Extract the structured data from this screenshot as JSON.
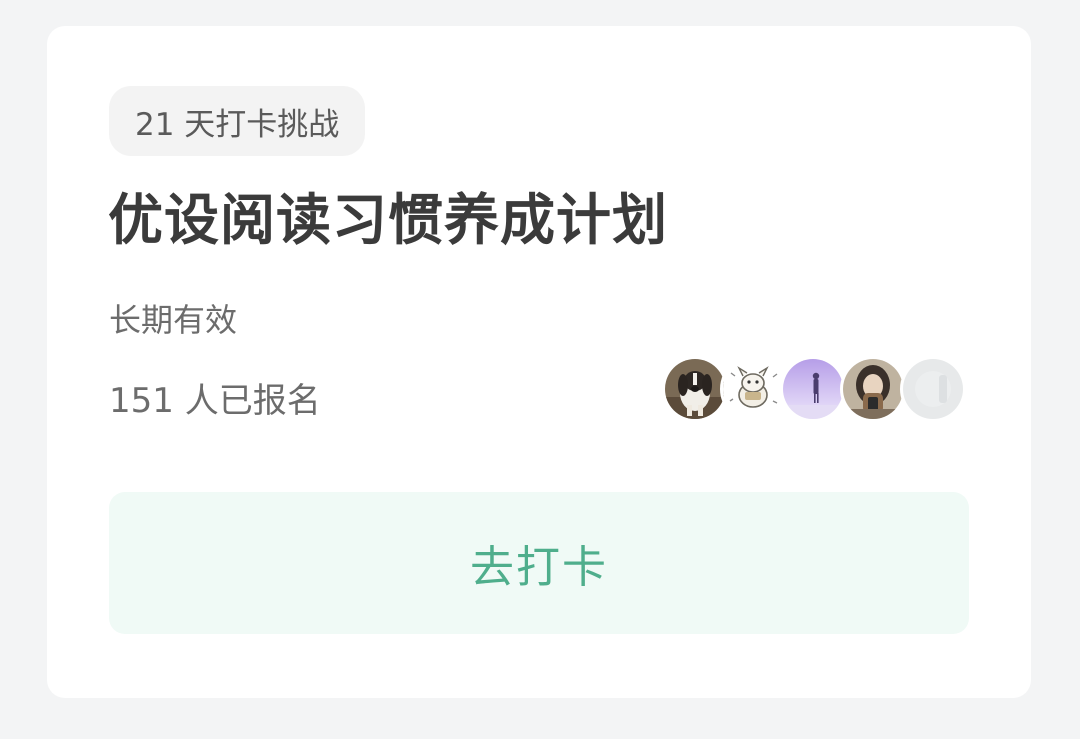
{
  "challenge": {
    "badge_label": "21 天打卡挑战",
    "title": "优设阅读习惯养成计划",
    "validity": "长期有效",
    "signups_text": "151 人已报名",
    "participant_avatars": [
      {
        "name": "dog-avatar"
      },
      {
        "name": "cartoon-character-avatar"
      },
      {
        "name": "purple-silhouette-avatar"
      },
      {
        "name": "girl-selfie-avatar"
      },
      {
        "name": "blurred-gray-avatar"
      }
    ],
    "checkin_button_label": "去打卡"
  },
  "colors": {
    "page_background": "#f3f4f5",
    "card_background": "#ffffff",
    "badge_background": "#f3f3f3",
    "title_text": "#3b3b3b",
    "secondary_text": "#6c6c6c",
    "button_background": "#f0faf6",
    "button_text": "#4fae8c"
  }
}
